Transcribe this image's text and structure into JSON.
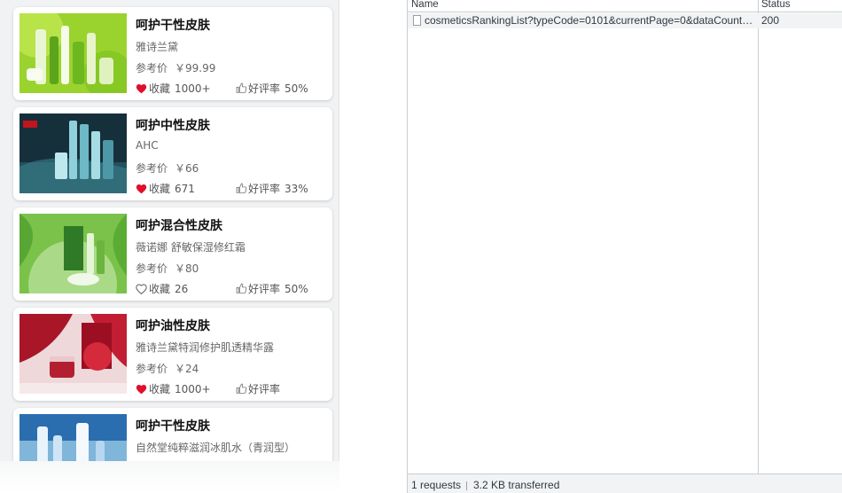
{
  "products": [
    {
      "title": "呵护干性皮肤",
      "brand": "雅诗兰黛",
      "price_label": "参考价",
      "price": "￥99.99",
      "favorite_label": "收藏",
      "favorite_count": "1000+",
      "favorited": true,
      "rating_label": "好评率",
      "rating": "50%",
      "image_theme": "green-bottles"
    },
    {
      "title": "呵护中性皮肤",
      "brand": "AHC",
      "price_label": "参考价",
      "price": "￥66",
      "favorite_label": "收藏",
      "favorite_count": "671",
      "favorited": true,
      "rating_label": "好评率",
      "rating": "33%",
      "image_theme": "teal-bottles"
    },
    {
      "title": "呵护混合性皮肤",
      "brand": "薇诺娜 舒敏保湿修红霜",
      "price_label": "参考价",
      "price": "￥80",
      "favorite_label": "收藏",
      "favorite_count": "26",
      "favorited": false,
      "rating_label": "好评率",
      "rating": "50%",
      "image_theme": "green-cream"
    },
    {
      "title": "呵护油性皮肤",
      "brand": "雅诗兰黛特润修护肌透精华露",
      "price_label": "参考价",
      "price": "￥24",
      "favorite_label": "收藏",
      "favorite_count": "1000+",
      "favorited": true,
      "rating_label": "好评率",
      "rating": "",
      "image_theme": "red-jar"
    },
    {
      "title": "呵护干性皮肤",
      "brand": "自然堂纯粹滋润冰肌水（青润型）",
      "price_label": "",
      "price": "",
      "favorite_label": "",
      "favorite_count": "",
      "favorited": false,
      "rating_label": "",
      "rating": "",
      "image_theme": "blue-bottles"
    }
  ],
  "network": {
    "columns": {
      "name": "Name",
      "status": "Status"
    },
    "requests": [
      {
        "name": "cosmeticsRankingList?typeCode=0101&currentPage=0&dataCount=...",
        "status": "200"
      }
    ],
    "summary": {
      "requests": "1 requests",
      "transferred": "3.2 KB transferred"
    }
  },
  "colors": {
    "heart": "#e0102a",
    "text_muted": "#666666",
    "card_bg": "#ffffff",
    "page_bg": "#f1f2f3"
  }
}
